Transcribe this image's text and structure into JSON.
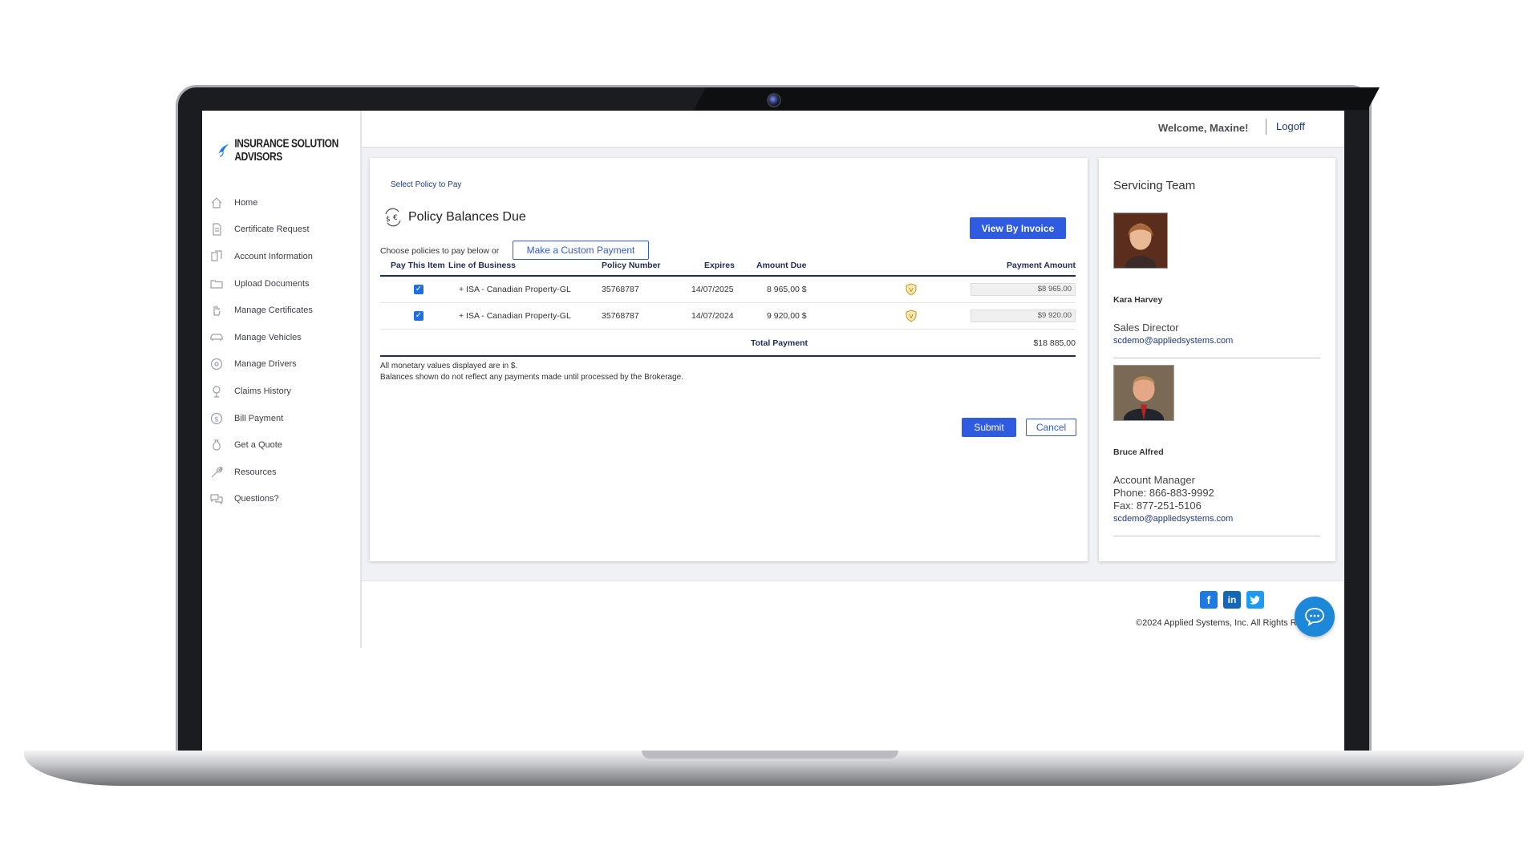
{
  "header": {
    "welcome": "Welcome, Maxine!",
    "logoff": "Logoff"
  },
  "brand": {
    "name": "INSURANCE SOLUTION ADVISORS"
  },
  "sidebar": {
    "items": [
      {
        "label": "Home",
        "icon": "home-icon"
      },
      {
        "label": "Certificate Request",
        "icon": "document-icon"
      },
      {
        "label": "Account Information",
        "icon": "copy-icon"
      },
      {
        "label": "Upload Documents",
        "icon": "folder-icon"
      },
      {
        "label": "Manage Certificates",
        "icon": "hand-icon"
      },
      {
        "label": "Manage Vehicles",
        "icon": "car-icon"
      },
      {
        "label": "Manage Drivers",
        "icon": "steering-wheel-icon"
      },
      {
        "label": "Claims History",
        "icon": "pin-icon"
      },
      {
        "label": "Bill Payment",
        "icon": "dollar-icon"
      },
      {
        "label": "Get a Quote",
        "icon": "money-bag-icon"
      },
      {
        "label": "Resources",
        "icon": "wrench-icon"
      },
      {
        "label": "Questions?",
        "icon": "chat-icon"
      }
    ]
  },
  "payment": {
    "breadcrumb": "Select Policy to Pay",
    "title": "Policy Balances Due",
    "view_invoice": "View By Invoice",
    "choose_text": "Choose policies to pay below or",
    "custom_payment": "Make a Custom Payment",
    "columns": {
      "pay": "Pay This Item",
      "lob": "Line of Business",
      "policy": "Policy Number",
      "expires": "Expires",
      "amount": "Amount Due",
      "payment": "Payment Amount"
    },
    "rows": [
      {
        "checked": true,
        "lob": "+ ISA - Canadian Property-GL",
        "policy": "35768787",
        "expires": "14/07/2025",
        "amount": "8 965,00 $",
        "payment": "$8 965.00"
      },
      {
        "checked": true,
        "lob": "+ ISA - Canadian Property-GL",
        "policy": "35768787",
        "expires": "14/07/2024",
        "amount": "9 920,00 $",
        "payment": "$9 920.00"
      }
    ],
    "total_label": "Total Payment",
    "total_value": "$18 885,00",
    "note1": "All monetary values displayed are in $.",
    "note2": "Balances shown do not reflect any payments made until processed by the Brokerage.",
    "submit": "Submit",
    "cancel": "Cancel"
  },
  "team": {
    "title": "Servicing Team",
    "members": [
      {
        "name": "Kara Harvey",
        "role": "Sales Director",
        "email": "scdemo@appliedsystems.com"
      },
      {
        "name": "Bruce Alfred",
        "role": "Account Manager",
        "phone": "Phone: 866-883-9992",
        "fax": "Fax: 877-251-5106",
        "email": "scdemo@appliedsystems.com"
      }
    ]
  },
  "footer": {
    "copyright": "©2024 Applied Systems, Inc. All Rights Reserved.",
    "social": [
      "facebook-icon",
      "linkedin-icon",
      "twitter-icon"
    ]
  },
  "colors": {
    "primary": "#2f5be0",
    "navy": "#1f2d52",
    "link": "#1f3a78",
    "chat": "#1e88d8"
  }
}
